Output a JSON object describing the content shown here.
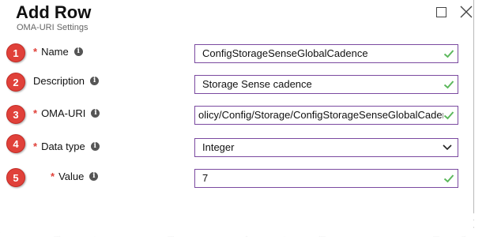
{
  "header": {
    "title": "Add Row",
    "subtitle": "OMA-URI Settings"
  },
  "rows": [
    {
      "badge": "1",
      "required": true,
      "label": "Name",
      "value": "ConfigStorageSenseGlobalCadence",
      "control": "text"
    },
    {
      "badge": "2",
      "required": false,
      "label": "Description",
      "value": "Storage Sense cadence",
      "control": "text"
    },
    {
      "badge": "3",
      "required": true,
      "label": "OMA-URI",
      "value": "olicy/Config/Storage/ConfigStorageSenseGlobalCaden",
      "control": "text"
    },
    {
      "badge": "4",
      "required": true,
      "label": "Data type",
      "value": "Integer",
      "control": "select"
    },
    {
      "badge": "5",
      "required": true,
      "label": "Value",
      "value": "7",
      "control": "text"
    }
  ],
  "symbols": {
    "required": "*",
    "info": "i"
  },
  "icons": {
    "maximize": "maximize-icon",
    "close": "close-icon",
    "check": "checkmark-icon",
    "dropdown": "chevron-down-icon",
    "info": "info-icon"
  },
  "colors": {
    "badge": "#e0413a",
    "required": "#e0413a",
    "field_border": "#7b4aa0",
    "check": "#5cb85c"
  }
}
